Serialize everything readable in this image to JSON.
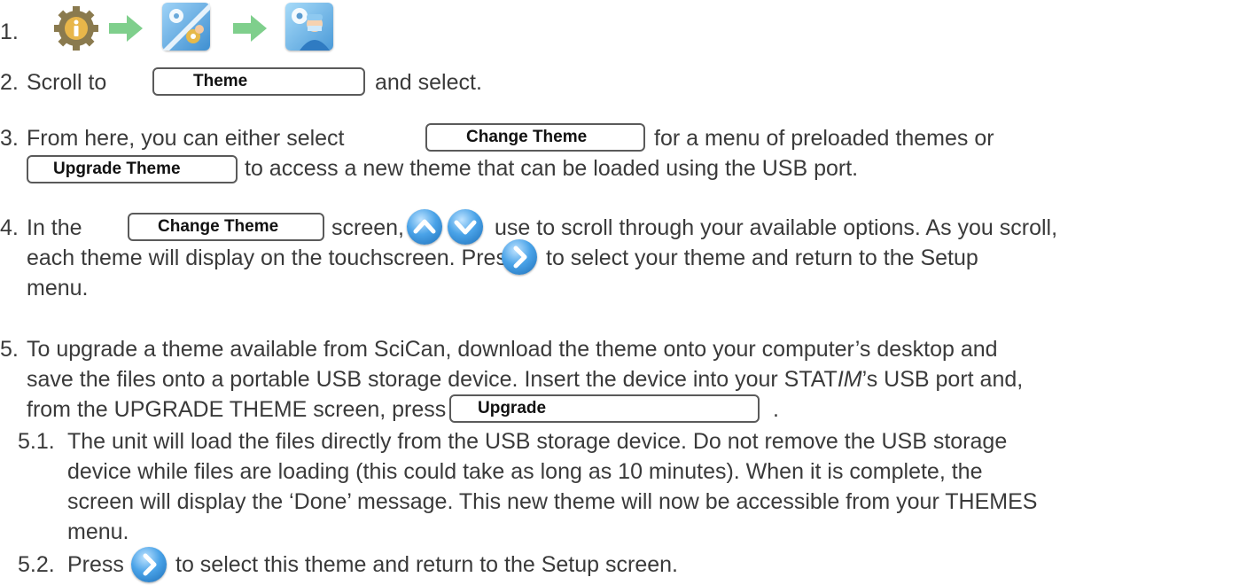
{
  "steps": [
    {
      "num": "1."
    },
    {
      "num": "2.",
      "pre": "Scroll to",
      "btn": "Theme",
      "post": "and select."
    },
    {
      "num": "3.",
      "pre": "From here, you can either select",
      "btn": "Change Theme",
      "post": "for a menu of preloaded themes or",
      "btn2": "Upgrade Theme",
      "post2": "to access a new theme that can be loaded using the USB port."
    },
    {
      "num": "4.",
      "pre": "In the",
      "btn": "Change Theme",
      "mid": "screen,",
      "post": "use to scroll through your available options. As you scroll,",
      "line2a": "each theme will display on the touchscreen. Press",
      "line2b": "to select your theme and return to the Setup",
      "line3": "menu."
    },
    {
      "num": "5.",
      "line1": "To upgrade a theme available from SciCan, download the theme onto your computer’s desktop and",
      "line2a": "save the files onto a portable USB storage device. Insert the device into your STAT",
      "line2i": "IM",
      "line2b": "’s USB port and,",
      "line3a": "from the UPGRADE THEME screen, press",
      "btn": "Upgrade",
      "line3b": "."
    },
    {
      "num": "5.1.",
      "line1": "The unit will load the files directly from the USB storage device. Do not remove the USB storage",
      "line2": "device while files are loading (this could take as long as 10 minutes). When it is complete, the",
      "line3": "screen will display the ‘Done’ message. This new theme will now be accessible from your THEMES",
      "line4": "menu."
    },
    {
      "num": "5.2.",
      "pre": "Press",
      "post": "to select this theme and return to the Setup screen."
    }
  ],
  "icons": {
    "info_gear": "info-gear-icon",
    "arrow": "green-right-arrow-icon",
    "technician": "technician-settings-icon",
    "doctor": "doctor-settings-icon",
    "up": "up-arrow-button-icon",
    "down": "down-arrow-button-icon",
    "right": "right-arrow-button-icon"
  },
  "colors": {
    "arrow": "#7fcf8c",
    "button_blue": "#2c86d6",
    "text": "#3a3a3a"
  }
}
